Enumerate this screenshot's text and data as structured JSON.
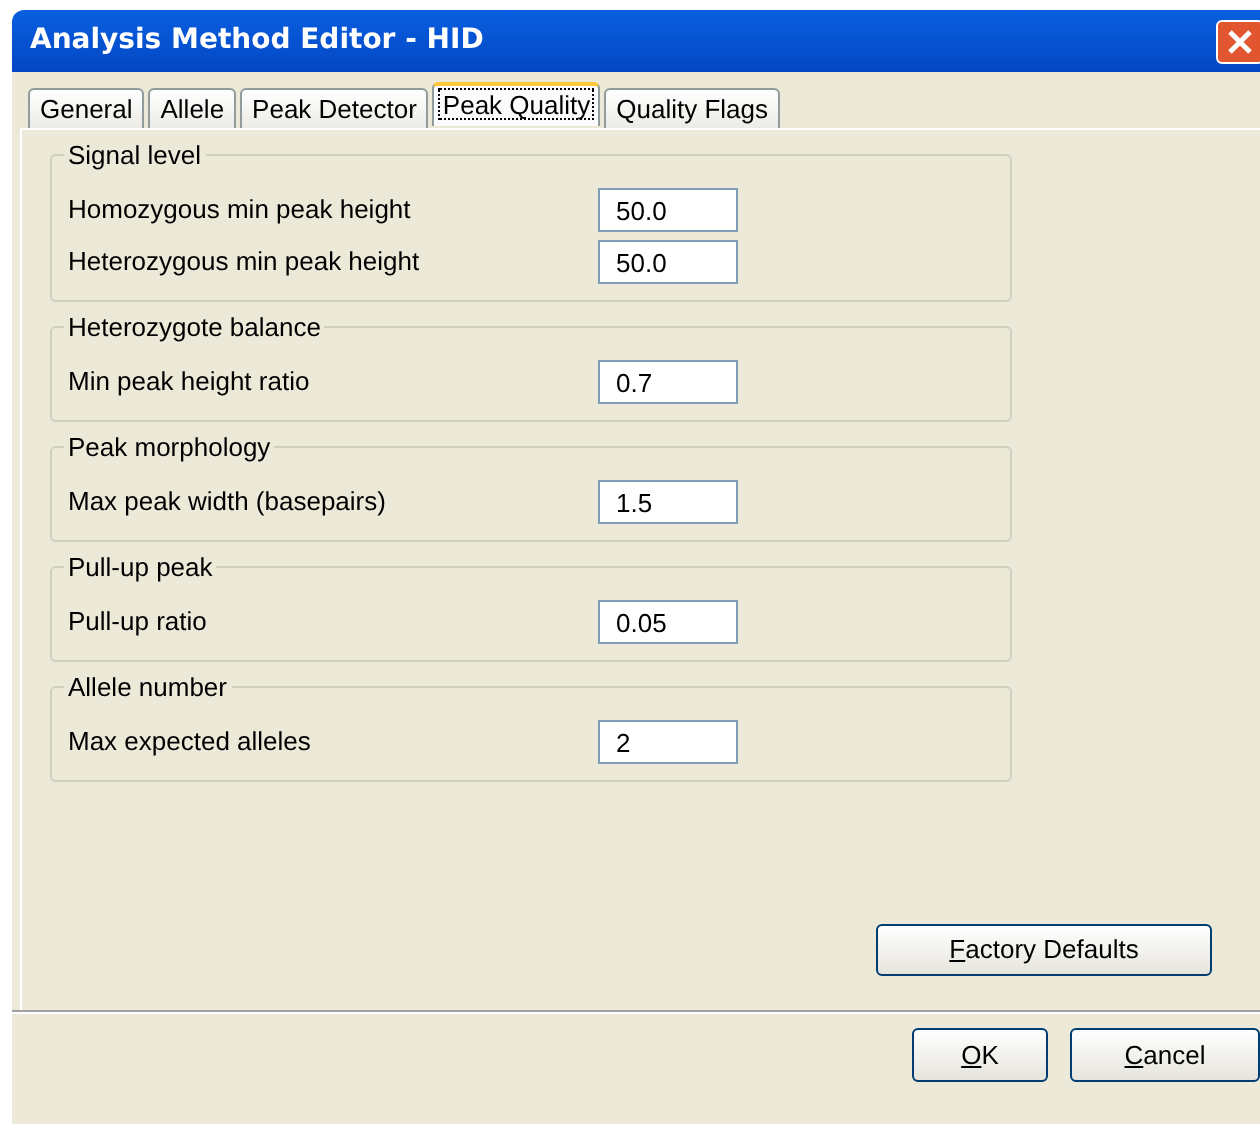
{
  "window": {
    "title": "Analysis Method Editor - HID"
  },
  "tabs": [
    {
      "label": "General",
      "selected": false
    },
    {
      "label": "Allele",
      "selected": false
    },
    {
      "label": "Peak Detector",
      "selected": false
    },
    {
      "label": "Peak Quality",
      "selected": true
    },
    {
      "label": "Quality Flags",
      "selected": false
    }
  ],
  "groups": [
    {
      "title": "Signal level",
      "fields": [
        {
          "label": "Homozygous min peak height",
          "value": "50.0"
        },
        {
          "label": "Heterozygous min peak height",
          "value": "50.0"
        }
      ]
    },
    {
      "title": "Heterozygote balance",
      "fields": [
        {
          "label": "Min peak height ratio",
          "value": "0.7"
        }
      ]
    },
    {
      "title": "Peak morphology",
      "fields": [
        {
          "label": "Max peak width (basepairs)",
          "value": "1.5"
        }
      ]
    },
    {
      "title": "Pull-up peak",
      "fields": [
        {
          "label": "Pull-up ratio",
          "value": "0.05"
        }
      ]
    },
    {
      "title": "Allele number",
      "fields": [
        {
          "label": "Max expected alleles",
          "value": "2"
        }
      ]
    }
  ],
  "factory_button": "Factory Defaults",
  "buttons": [
    "OK",
    "Cancel"
  ]
}
